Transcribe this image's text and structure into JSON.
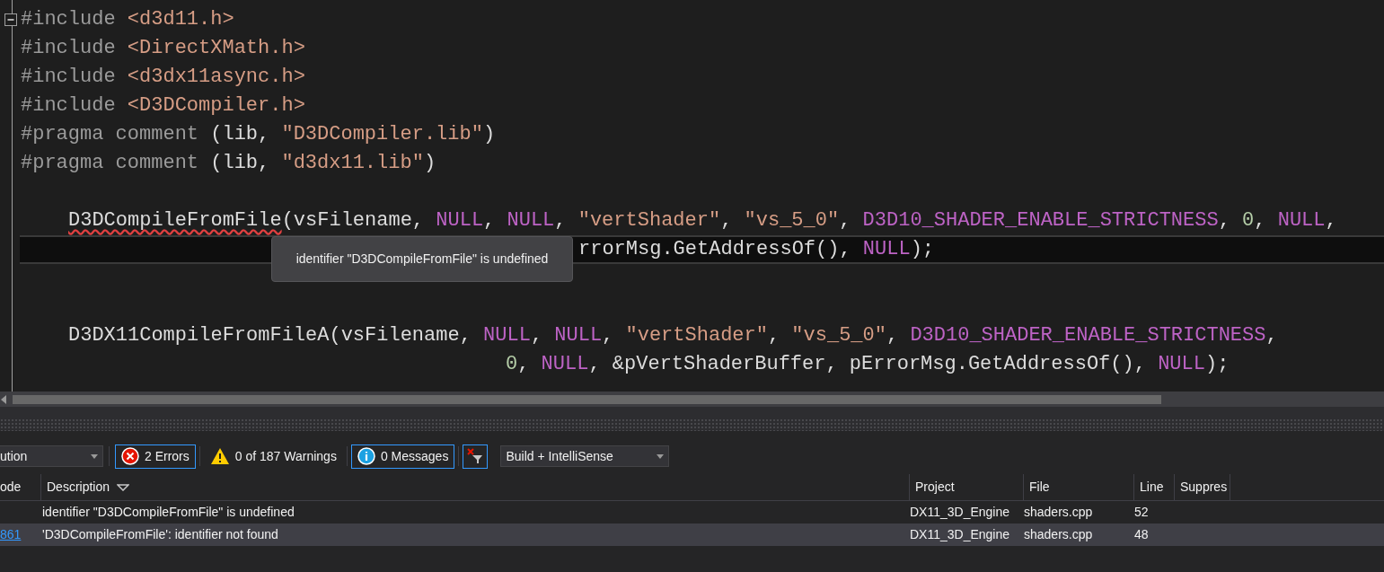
{
  "editor": {
    "lines": [
      {
        "kind": "top",
        "tokens": [
          {
            "kind": "directive",
            "text": "#include "
          },
          {
            "kind": "string",
            "text": "<d3d11.h>"
          }
        ],
        "fold": true,
        "current": false
      },
      {
        "kind": "top",
        "tokens": [
          {
            "kind": "directive",
            "text": "#include "
          },
          {
            "kind": "string",
            "text": "<DirectXMath.h>"
          }
        ],
        "fold": false,
        "current": false
      },
      {
        "kind": "top",
        "tokens": [
          {
            "kind": "directive",
            "text": "#include "
          },
          {
            "kind": "string",
            "text": "<d3dx11async.h>"
          }
        ],
        "fold": false,
        "current": false
      },
      {
        "kind": "top",
        "tokens": [
          {
            "kind": "directive",
            "text": "#include "
          },
          {
            "kind": "string",
            "text": "<D3DCompiler.h>"
          }
        ],
        "fold": false,
        "current": false
      },
      {
        "kind": "top",
        "tokens": [
          {
            "kind": "directive",
            "text": "#pragma comment "
          },
          {
            "kind": "plain",
            "text": "(lib, "
          },
          {
            "kind": "string",
            "text": "\"D3DCompiler.lib\""
          },
          {
            "kind": "plain",
            "text": ")"
          }
        ],
        "fold": false,
        "current": false
      },
      {
        "kind": "top",
        "tokens": [
          {
            "kind": "directive",
            "text": "#pragma comment "
          },
          {
            "kind": "plain",
            "text": "(lib, "
          },
          {
            "kind": "string",
            "text": "\"d3dx11.lib\""
          },
          {
            "kind": "plain",
            "text": ")"
          }
        ],
        "fold": false,
        "current": false
      },
      {
        "kind": "blank"
      },
      {
        "kind": "statement",
        "tokens": [
          {
            "kind": "error",
            "text": "D3DCompileFromFile"
          },
          {
            "kind": "plain",
            "text": "(vsFilename, "
          },
          {
            "kind": "macro",
            "text": "NULL"
          },
          {
            "kind": "plain",
            "text": ", "
          },
          {
            "kind": "macro",
            "text": "NULL"
          },
          {
            "kind": "plain",
            "text": ", "
          },
          {
            "kind": "string",
            "text": "\"vertShader\""
          },
          {
            "kind": "plain",
            "text": ", "
          },
          {
            "kind": "string",
            "text": "\"vs_5_0\""
          },
          {
            "kind": "plain",
            "text": ", "
          },
          {
            "kind": "macro",
            "text": "D3D10_SHADER_ENABLE_STRICTNESS"
          },
          {
            "kind": "plain",
            "text": ", "
          },
          {
            "kind": "number",
            "text": "0"
          },
          {
            "kind": "plain",
            "text": ", "
          },
          {
            "kind": "macro",
            "text": "NULL"
          },
          {
            "kind": "plain",
            "text": ","
          }
        ],
        "fold": false,
        "current": false
      },
      {
        "kind": "covered",
        "tokens": [
          {
            "kind": "plain",
            "text": "rrorMsg.GetAddressOf(), "
          },
          {
            "kind": "macro",
            "text": "NULL"
          },
          {
            "kind": "plain",
            "text": ");"
          }
        ],
        "fold": false,
        "current": true
      },
      {
        "kind": "blank"
      },
      {
        "kind": "blank"
      },
      {
        "kind": "statement",
        "tokens": [
          {
            "kind": "plain",
            "text": "D3DX11CompileFromFileA(vsFilename, "
          },
          {
            "kind": "macro",
            "text": "NULL"
          },
          {
            "kind": "plain",
            "text": ", "
          },
          {
            "kind": "macro",
            "text": "NULL"
          },
          {
            "kind": "plain",
            "text": ", "
          },
          {
            "kind": "string",
            "text": "\"vertShader\""
          },
          {
            "kind": "plain",
            "text": ", "
          },
          {
            "kind": "string",
            "text": "\"vs_5_0\""
          },
          {
            "kind": "plain",
            "text": ", "
          },
          {
            "kind": "macro",
            "text": "D3D10_SHADER_ENABLE_STRICTNESS"
          },
          {
            "kind": "plain",
            "text": ","
          }
        ],
        "fold": false,
        "current": false
      },
      {
        "kind": "continuation",
        "tokens": [
          {
            "kind": "number",
            "text": "0"
          },
          {
            "kind": "plain",
            "text": ", "
          },
          {
            "kind": "macro",
            "text": "NULL"
          },
          {
            "kind": "plain",
            "text": ", &pVertShaderBuffer, pErrorMsg.GetAddressOf(), "
          },
          {
            "kind": "macro",
            "text": "NULL"
          },
          {
            "kind": "plain",
            "text": ");"
          }
        ],
        "fold": false,
        "current": false
      }
    ],
    "tooltip": "identifier \"D3DCompileFromFile\" is undefined"
  },
  "error_list": {
    "scope_dropdown": "ution",
    "filters": [
      {
        "kind": "error",
        "label": "2 Errors",
        "selected": true
      },
      {
        "kind": "warning",
        "label": "0 of 187 Warnings",
        "selected": false
      },
      {
        "kind": "message",
        "label": "0 Messages",
        "selected": true
      }
    ],
    "clear_filter": {
      "selected": true
    },
    "source_dropdown": "Build + IntelliSense",
    "columns": [
      "ode",
      "Description",
      "Project",
      "File",
      "Line",
      "Suppres"
    ],
    "rows": [
      {
        "description": "identifier \"D3DCompileFromFile\" is undefined",
        "project": "DX11_3D_Engine",
        "file": "shaders.cpp",
        "line": "52",
        "selected": false
      },
      {
        "code": "861",
        "description": "'D3DCompileFromFile': identifier not found",
        "project": "DX11_3D_Engine",
        "file": "shaders.cpp",
        "line": "48",
        "selected": true
      }
    ]
  }
}
